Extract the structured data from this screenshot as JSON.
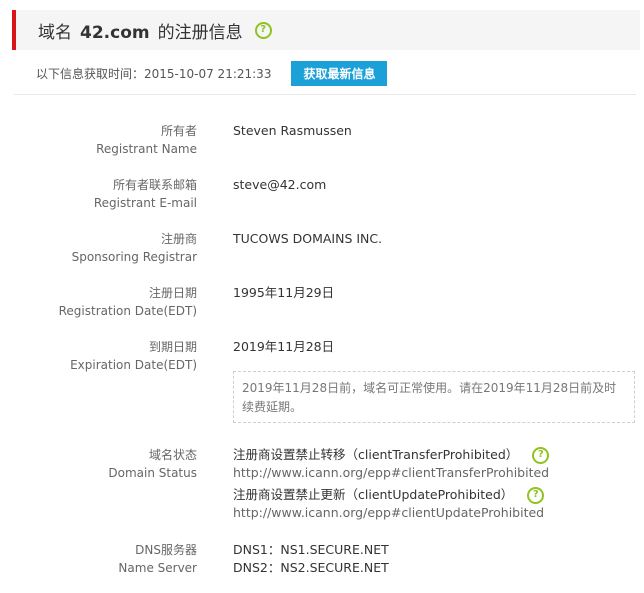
{
  "header": {
    "prefix": "域名",
    "domain": "42.com",
    "suffix": "的注册信息",
    "help_symbol": "?"
  },
  "fetch": {
    "time_text": "以下信息获取时间：2015-10-07 21:21:33",
    "refresh_label": "获取最新信息"
  },
  "fields": {
    "registrant_name": {
      "label_cn": "所有者",
      "label_en": "Registrant Name",
      "value": "Steven Rasmussen"
    },
    "registrant_email": {
      "label_cn": "所有者联系邮箱",
      "label_en": "Registrant E-mail",
      "value": "steve@42.com"
    },
    "registrar": {
      "label_cn": "注册商",
      "label_en": "Sponsoring Registrar",
      "value": "TUCOWS DOMAINS INC."
    },
    "registration_date": {
      "label_cn": "注册日期",
      "label_en": "Registration Date(EDT)",
      "value": "1995年11月29日"
    },
    "expiration_date": {
      "label_cn": "到期日期",
      "label_en": "Expiration Date(EDT)",
      "value": "2019年11月28日"
    }
  },
  "expiry_note": "2019年11月28日前，域名可正常使用。请在2019年11月28日前及时续费延期。",
  "domain_status": {
    "label_cn": "域名状态",
    "label_en": "Domain Status",
    "items": [
      {
        "text": "注册商设置禁止转移（clientTransferProhibited）",
        "url": "http://www.icann.org/epp#clientTransferProhibited"
      },
      {
        "text": "注册商设置禁止更新（clientUpdateProhibited）",
        "url": "http://www.icann.org/epp#clientUpdateProhibited"
      }
    ]
  },
  "name_servers": {
    "label_cn": "DNS服务器",
    "label_en": "Name Server",
    "items": [
      "DNS1：NS1.SECURE.NET",
      "DNS2：NS2.SECURE.NET"
    ]
  },
  "colors": {
    "accent_red": "#d9141b",
    "button_blue": "#1ba0d8",
    "help_green": "#8fc31f"
  }
}
